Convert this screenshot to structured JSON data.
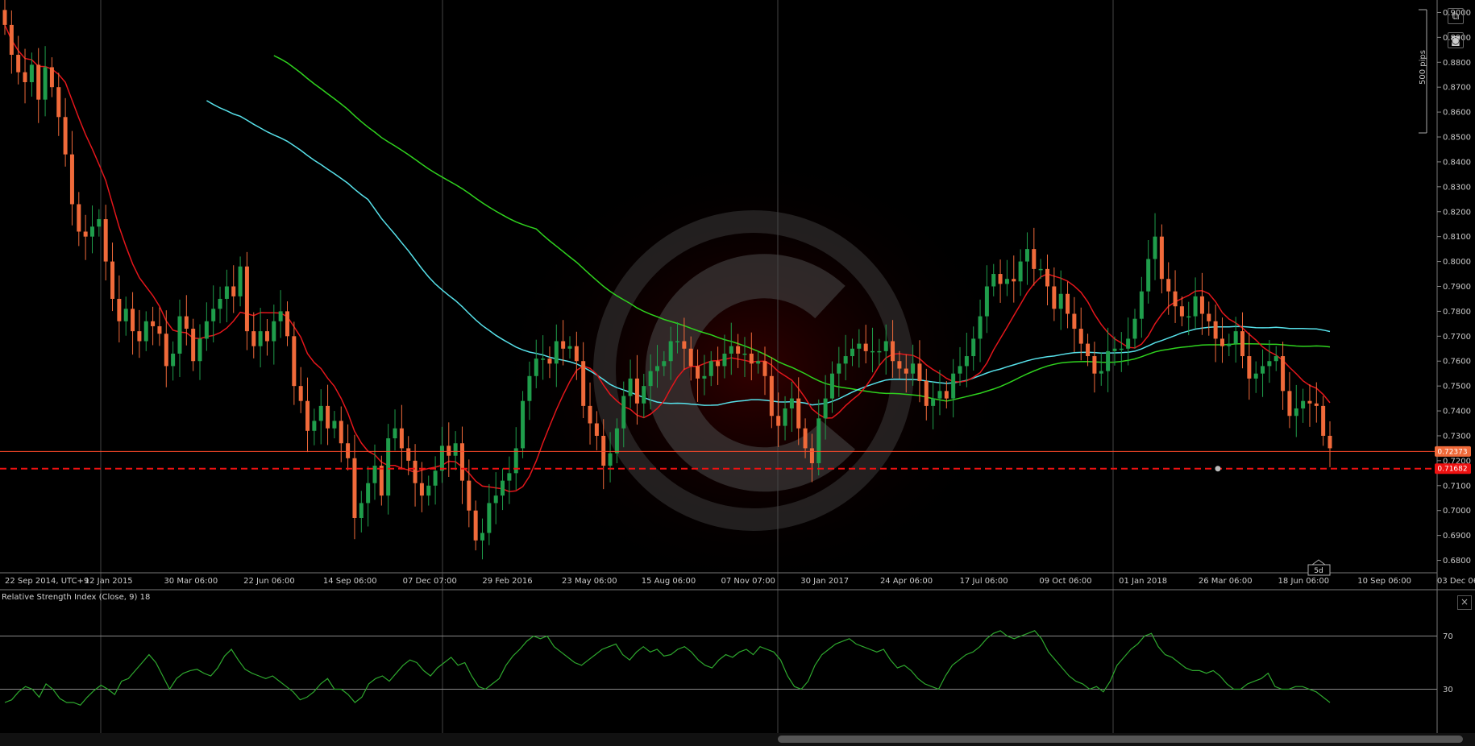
{
  "toolbar": {
    "popout_icon": "popout-icon",
    "camera_icon": "camera-icon"
  },
  "scale_label": "500 pips",
  "period_label": "5d",
  "rsi": {
    "title": "Relative Strength Index (Close, 9) 18",
    "levels": [
      70,
      30
    ],
    "close_glyph": "×"
  },
  "colors": {
    "up": "#1f9d4b",
    "down": "#f06a3a",
    "sma_red": "#e4161b",
    "sma_cyan": "#57e1ea",
    "sma_green": "#2fd21e",
    "rsi_line": "#2ea82e"
  },
  "chart_data": {
    "type": "candlestick",
    "instrument_price_current": "0.72373",
    "horizontal_line_price": "0.71682",
    "y_ticks": [
      "0.9000",
      "0.8900",
      "0.8800",
      "0.8700",
      "0.8600",
      "0.8500",
      "0.8400",
      "0.8300",
      "0.8200",
      "0.8100",
      "0.8000",
      "0.7900",
      "0.7800",
      "0.7700",
      "0.7600",
      "0.7500",
      "0.7400",
      "0.7300",
      "0.7200",
      "0.7100",
      "0.7000",
      "0.6900",
      "0.6800"
    ],
    "ylim": [
      0.675,
      0.905
    ],
    "x_labels": [
      "22 Sep 2014, UTC+9",
      "12 Jan 2015",
      "30 Mar 06:00",
      "22 Jun 06:00",
      "14 Sep 06:00",
      "07 Dec 07:00",
      "29 Feb 2016",
      "23 May 06:00",
      "15 Aug 06:00",
      "07 Nov 07:00",
      "30 Jan 2017",
      "24 Apr 06:00",
      "17 Jul 06:00",
      "09 Oct 06:00",
      "01 Jan 2018",
      "26 Mar 06:00",
      "18 Jun 06:00",
      "10 Sep 06:00",
      "03 Dec 06:00"
    ],
    "closes": [
      0.895,
      0.883,
      0.876,
      0.872,
      0.879,
      0.865,
      0.878,
      0.87,
      0.858,
      0.843,
      0.823,
      0.812,
      0.81,
      0.814,
      0.817,
      0.8,
      0.785,
      0.776,
      0.781,
      0.772,
      0.768,
      0.776,
      0.774,
      0.771,
      0.758,
      0.763,
      0.778,
      0.773,
      0.76,
      0.769,
      0.776,
      0.781,
      0.785,
      0.79,
      0.786,
      0.798,
      0.772,
      0.766,
      0.772,
      0.768,
      0.776,
      0.78,
      0.77,
      0.75,
      0.744,
      0.732,
      0.736,
      0.742,
      0.733,
      0.736,
      0.727,
      0.721,
      0.697,
      0.703,
      0.711,
      0.718,
      0.706,
      0.729,
      0.733,
      0.725,
      0.72,
      0.711,
      0.706,
      0.71,
      0.716,
      0.726,
      0.722,
      0.727,
      0.712,
      0.7,
      0.688,
      0.691,
      0.703,
      0.706,
      0.712,
      0.715,
      0.725,
      0.744,
      0.754,
      0.761,
      0.761,
      0.759,
      0.768,
      0.765,
      0.766,
      0.76,
      0.742,
      0.735,
      0.73,
      0.718,
      0.723,
      0.733,
      0.746,
      0.753,
      0.743,
      0.75,
      0.756,
      0.758,
      0.76,
      0.768,
      0.768,
      0.765,
      0.758,
      0.753,
      0.754,
      0.76,
      0.758,
      0.763,
      0.766,
      0.763,
      0.763,
      0.759,
      0.76,
      0.754,
      0.738,
      0.734,
      0.741,
      0.745,
      0.733,
      0.725,
      0.719,
      0.737,
      0.745,
      0.755,
      0.759,
      0.762,
      0.765,
      0.767,
      0.764,
      0.764,
      0.764,
      0.768,
      0.76,
      0.757,
      0.755,
      0.759,
      0.752,
      0.742,
      0.745,
      0.748,
      0.745,
      0.755,
      0.758,
      0.762,
      0.769,
      0.778,
      0.79,
      0.795,
      0.791,
      0.793,
      0.792,
      0.8,
      0.805,
      0.797,
      0.797,
      0.79,
      0.781,
      0.787,
      0.779,
      0.773,
      0.767,
      0.762,
      0.755,
      0.756,
      0.764,
      0.765,
      0.765,
      0.769,
      0.777,
      0.788,
      0.801,
      0.81,
      0.793,
      0.788,
      0.782,
      0.778,
      0.778,
      0.786,
      0.779,
      0.776,
      0.769,
      0.766,
      0.767,
      0.772,
      0.762,
      0.753,
      0.755,
      0.758,
      0.76,
      0.762,
      0.748,
      0.738,
      0.741,
      0.744,
      0.743,
      0.742,
      0.73,
      0.725
    ],
    "sma_fast_name": "",
    "sma_mid_name": "",
    "sma_slow_name": "",
    "rsi_values": [
      20,
      22,
      28,
      32,
      30,
      24,
      34,
      30,
      23,
      20,
      20,
      18,
      24,
      29,
      33,
      30,
      26,
      36,
      38,
      44,
      50,
      56,
      50,
      40,
      30,
      38,
      42,
      44,
      45,
      42,
      40,
      46,
      55,
      60,
      52,
      45,
      42,
      40,
      38,
      40,
      36,
      32,
      28,
      22,
      24,
      28,
      34,
      38,
      30,
      30,
      26,
      20,
      24,
      34,
      38,
      40,
      36,
      42,
      48,
      52,
      50,
      44,
      40,
      46,
      50,
      54,
      48,
      50,
      40,
      32,
      30,
      34,
      38,
      48,
      55,
      60,
      66,
      70,
      68,
      70,
      62,
      58,
      54,
      50,
      48,
      52,
      56,
      60,
      62,
      64,
      56,
      52,
      58,
      62,
      58,
      60,
      55,
      56,
      60,
      62,
      58,
      52,
      48,
      46,
      52,
      56,
      54,
      58,
      60,
      56,
      62,
      60,
      58,
      52,
      40,
      32,
      30,
      36,
      48,
      56,
      60,
      64,
      66,
      68,
      64,
      62,
      60,
      58,
      60,
      52,
      46,
      48,
      44,
      38,
      34,
      32,
      30,
      40,
      48,
      52,
      56,
      58,
      62,
      68,
      72,
      74,
      70,
      68,
      70,
      72,
      74,
      68,
      58,
      52,
      46,
      40,
      36,
      34,
      30,
      32,
      28,
      36,
      48,
      54,
      60,
      64,
      70,
      72,
      62,
      56,
      54,
      50,
      46,
      44,
      44,
      42,
      44,
      40,
      34,
      30,
      30,
      34,
      36,
      38,
      42,
      32,
      30,
      30,
      32,
      32,
      30,
      28,
      24,
      20
    ]
  }
}
